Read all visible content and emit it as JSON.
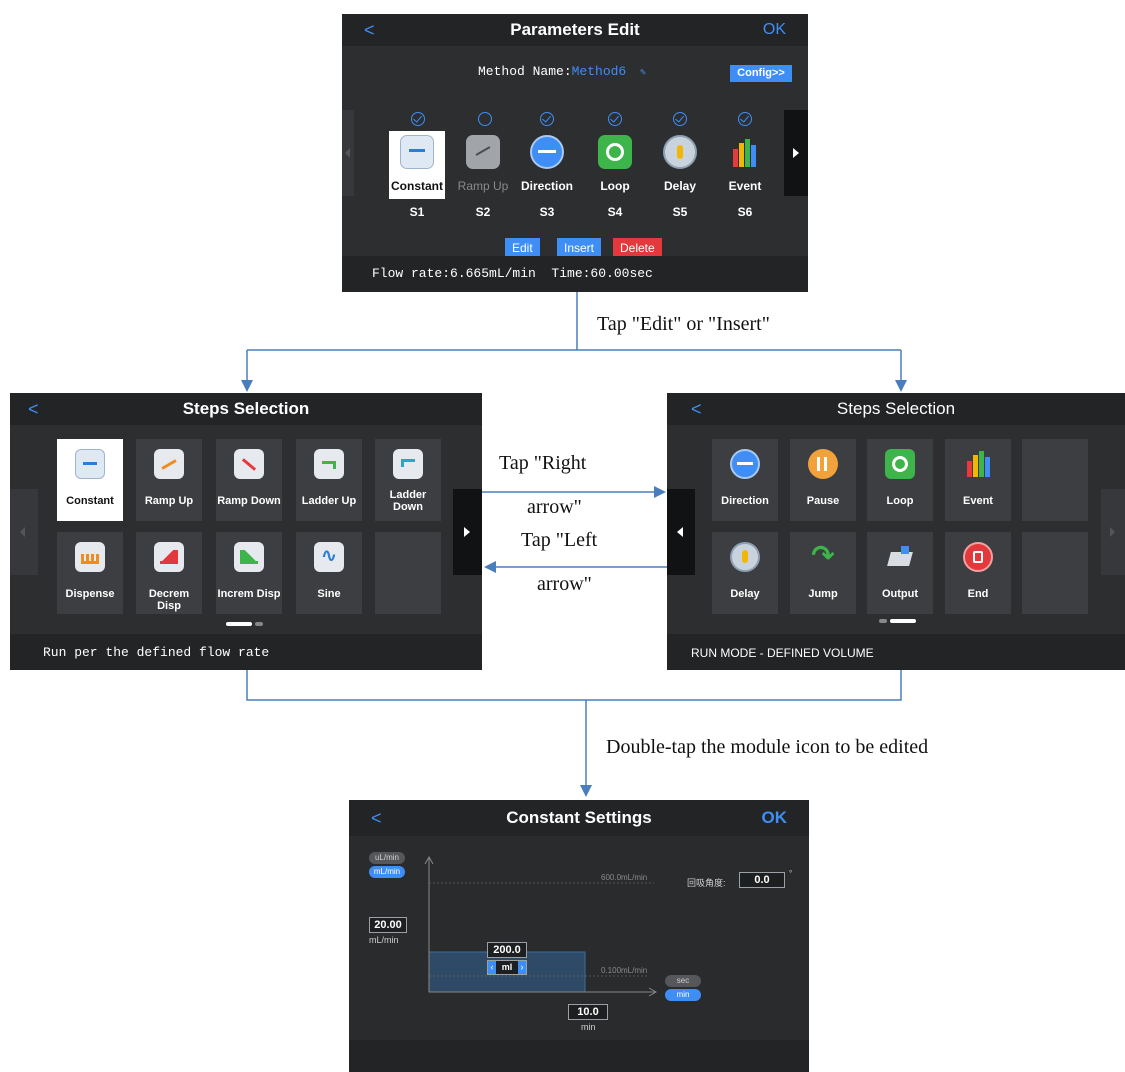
{
  "colors": {
    "accent": "#3f8ef5",
    "delete": "#e4393c",
    "flow_line": "#4a7ebb",
    "screen_bg": "#2d2e30"
  },
  "params_screen": {
    "back": "<",
    "title": "Parameters Edit",
    "ok": "OK",
    "method_label": "Method Name:",
    "method_value": "Method6",
    "edit_icon": "pencil-icon",
    "config_button": "Config>>",
    "steps": [
      {
        "label": "Constant",
        "sub": "S1",
        "checked": true,
        "icon": "constant-icon"
      },
      {
        "label": "Ramp Up",
        "sub": "S2",
        "checked": false,
        "icon": "ramp-up-icon"
      },
      {
        "label": "Direction",
        "sub": "S3",
        "checked": true,
        "icon": "direction-icon"
      },
      {
        "label": "Loop",
        "sub": "S4",
        "checked": true,
        "icon": "loop-icon"
      },
      {
        "label": "Delay",
        "sub": "S5",
        "checked": true,
        "icon": "delay-icon"
      },
      {
        "label": "Event",
        "sub": "S6",
        "checked": true,
        "icon": "event-icon"
      }
    ],
    "buttons": {
      "edit": "Edit",
      "insert": "Insert",
      "delete": "Delete"
    },
    "status": "Flow rate:6.665mL/min  Time:60.00sec"
  },
  "arrow_labels": {
    "edit_insert": "Tap \"Edit\" or \"Insert\"",
    "right_1": "Tap \"Right",
    "right_2": "arrow\"",
    "left_1": "Tap \"Left",
    "left_2": "arrow\"",
    "double_tap": "Double-tap the module icon to be edited"
  },
  "steps_left": {
    "back": "<",
    "title": "Steps Selection",
    "tiles": [
      {
        "label": "Constant",
        "icon": "constant-icon"
      },
      {
        "label": "Ramp Up",
        "icon": "ramp-up-icon"
      },
      {
        "label": "Ramp Down",
        "icon": "ramp-down-icon"
      },
      {
        "label": "Ladder Up",
        "icon": "ladder-up-icon"
      },
      {
        "label": "Ladder\nDown",
        "icon": "ladder-down-icon"
      },
      {
        "label": "Dispense",
        "icon": "dispense-icon"
      },
      {
        "label": "Decrem Disp",
        "icon": "decrem-disp-icon"
      },
      {
        "label": "Increm Disp",
        "icon": "increm-disp-icon"
      },
      {
        "label": "Sine",
        "icon": "sine-icon"
      }
    ],
    "status": "Run per the defined flow rate"
  },
  "steps_right": {
    "back": "<",
    "title": "Steps Selection",
    "tiles": [
      {
        "label": "Direction",
        "icon": "direction-icon"
      },
      {
        "label": "Pause",
        "icon": "pause-icon"
      },
      {
        "label": "Loop",
        "icon": "loop-icon"
      },
      {
        "label": "Event",
        "icon": "event-icon"
      },
      {
        "label": "Delay",
        "icon": "delay-icon"
      },
      {
        "label": "Jump",
        "icon": "jump-icon"
      },
      {
        "label": "Output",
        "icon": "output-icon"
      },
      {
        "label": "End",
        "icon": "end-icon"
      }
    ],
    "status": "RUN MODE - DEFINED VOLUME"
  },
  "constant_screen": {
    "back": "<",
    "title": "Constant Settings",
    "ok": "OK",
    "unit_ul": "uL/min",
    "unit_ml": "mL/min",
    "max_label": "600.0mL/min",
    "min_label": "0.100mL/min",
    "angle_label": "回吸角度:",
    "angle_value": "0.0",
    "angle_unit": "°",
    "rate_value": "20.00",
    "rate_unit": "mL/min",
    "volume_value": "200.0",
    "volume_unit": "ml",
    "time_value": "10.0",
    "time_unit": "min",
    "unit_sec": "sec",
    "unit_min": "min"
  }
}
